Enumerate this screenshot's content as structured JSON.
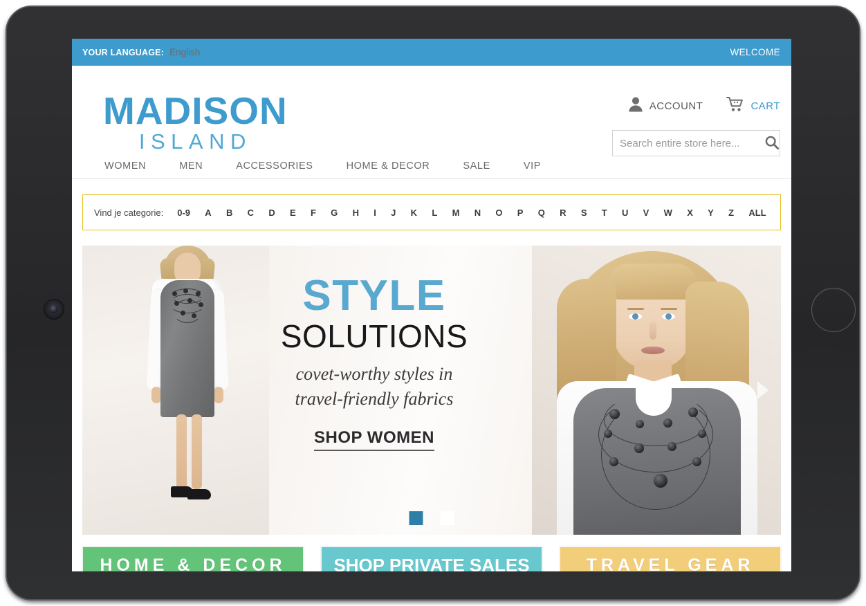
{
  "device": {
    "camera_icon": "camera-lens",
    "home_button_icon": "home-button"
  },
  "topbar": {
    "language_label": "YOUR LANGUAGE:",
    "language_value": "English",
    "welcome": "WELCOME"
  },
  "brand": {
    "name_primary": "MADISON",
    "name_secondary": "ISLAND",
    "primary_color": "#3d9bcd",
    "secondary_color": "#51a8d4"
  },
  "header": {
    "account_label": "ACCOUNT",
    "account_icon": "user-icon",
    "cart_label": "CART",
    "cart_icon": "shopping-cart-icon",
    "cart_color": "#3d9bcd"
  },
  "search": {
    "placeholder": "Search entire store here...",
    "value": "",
    "icon": "search-icon"
  },
  "nav": {
    "items": [
      {
        "label": "WOMEN"
      },
      {
        "label": "MEN"
      },
      {
        "label": "ACCESSORIES"
      },
      {
        "label": "HOME & DECOR"
      },
      {
        "label": "SALE"
      },
      {
        "label": "VIP"
      }
    ]
  },
  "alpha_filter": {
    "label": "Vind je categorie:",
    "border_color": "#e8c01f",
    "letters": [
      "0-9",
      "A",
      "B",
      "C",
      "D",
      "E",
      "F",
      "G",
      "H",
      "I",
      "J",
      "K",
      "L",
      "M",
      "N",
      "O",
      "P",
      "Q",
      "R",
      "S",
      "T",
      "U",
      "V",
      "W",
      "X",
      "Y",
      "Z",
      "ALL"
    ]
  },
  "hero": {
    "headline": "STYLE",
    "headline_color": "#58a8d0",
    "subhead": "SOLUTIONS",
    "tagline_line1": "covet-worthy styles in",
    "tagline_line2": "travel-friendly fabrics",
    "cta": "SHOP WOMEN",
    "next_arrow_icon": "chevron-right-icon",
    "slides": [
      {
        "active": true
      },
      {
        "active": false
      }
    ]
  },
  "promos": [
    {
      "label": "HOME & DECOR",
      "color": "#63c379"
    },
    {
      "label": "SHOP PRIVATE SALES",
      "color": "#67c9ce"
    },
    {
      "label": "TRAVEL GEAR",
      "color": "#f2cd7a"
    }
  ]
}
